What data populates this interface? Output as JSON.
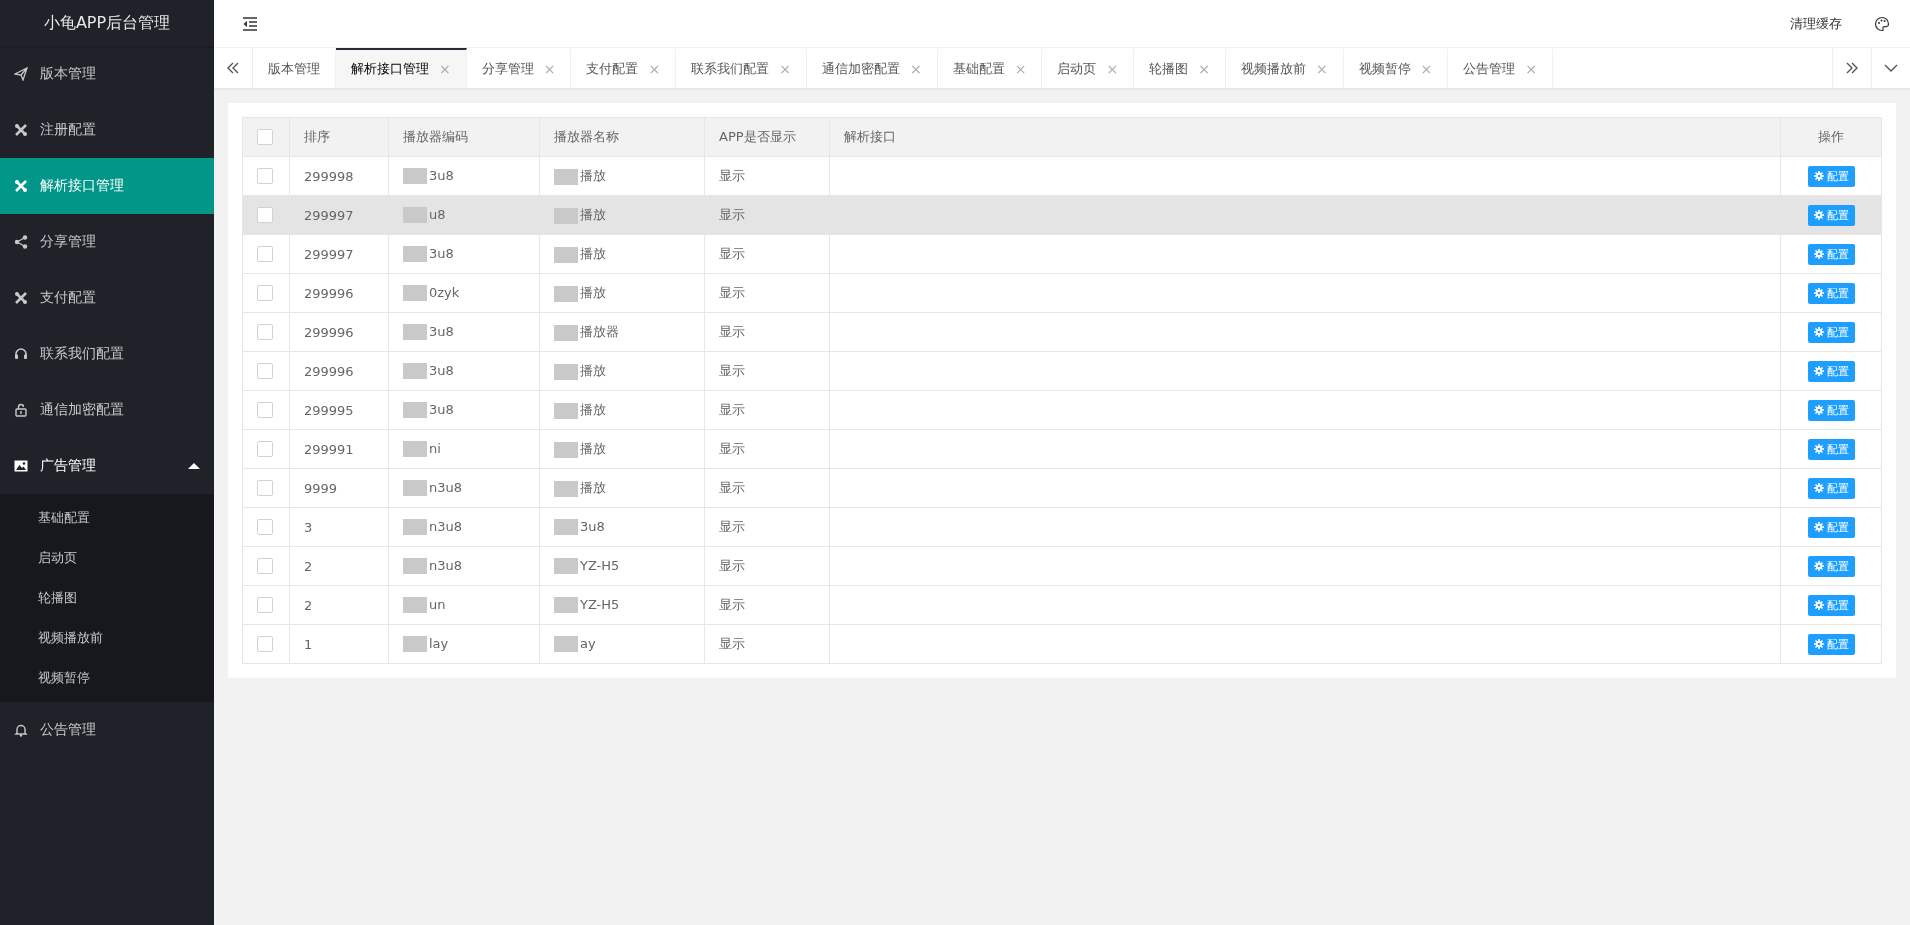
{
  "app_title": "小龟APP后台管理",
  "sidebar": {
    "items": [
      {
        "label": "版本管理",
        "kind": "send",
        "selected": false
      },
      {
        "label": "注册配置",
        "kind": "tools",
        "selected": false
      },
      {
        "label": "解析接口管理",
        "kind": "tools",
        "selected": true
      },
      {
        "label": "分享管理",
        "kind": "share",
        "selected": false
      },
      {
        "label": "支付配置",
        "kind": "tools",
        "selected": false
      },
      {
        "label": "联系我们配置",
        "kind": "headset",
        "selected": false
      },
      {
        "label": "通信加密配置",
        "kind": "lock",
        "selected": false
      },
      {
        "label": "广告管理",
        "kind": "image",
        "selected": false,
        "expanded": true,
        "children": [
          {
            "label": "基础配置",
            "selected": false
          },
          {
            "label": "启动页",
            "selected": false
          },
          {
            "label": "轮播图",
            "selected": false
          },
          {
            "label": "视频播放前",
            "selected": false
          },
          {
            "label": "视频暂停",
            "selected": false
          }
        ]
      },
      {
        "label": "公告管理",
        "kind": "bell",
        "selected": false
      }
    ]
  },
  "header": {
    "clear_cache": "清理缓存"
  },
  "tabs": [
    {
      "label": "版本管理",
      "selected": false,
      "closable": false
    },
    {
      "label": "解析接口管理",
      "selected": true,
      "closable": true
    },
    {
      "label": "分享管理",
      "selected": false,
      "closable": true
    },
    {
      "label": "支付配置",
      "selected": false,
      "closable": true
    },
    {
      "label": "联系我们配置",
      "selected": false,
      "closable": true
    },
    {
      "label": "通信加密配置",
      "selected": false,
      "closable": true
    },
    {
      "label": "基础配置",
      "selected": false,
      "closable": true
    },
    {
      "label": "启动页",
      "selected": false,
      "closable": true
    },
    {
      "label": "轮播图",
      "selected": false,
      "closable": true
    },
    {
      "label": "视频播放前",
      "selected": false,
      "closable": true
    },
    {
      "label": "视频暂停",
      "selected": false,
      "closable": true
    },
    {
      "label": "公告管理",
      "selected": false,
      "closable": true
    }
  ],
  "tab_close_glyph": "×",
  "table": {
    "header_checked": false,
    "columns": [
      "排序",
      "播放器编码",
      "播放器名称",
      "APP是否显示",
      "解析接口",
      "操作"
    ],
    "rows": [
      {
        "checked": false,
        "highlighted": false,
        "order": "299998",
        "code": "3u8",
        "name": "播放",
        "show": "显示",
        "action": "配置"
      },
      {
        "checked": false,
        "highlighted": true,
        "order": "299997",
        "code": "u8",
        "name": "播放",
        "show": "显示",
        "action": "配置"
      },
      {
        "checked": false,
        "highlighted": false,
        "order": "299997",
        "code": "3u8",
        "name": "播放",
        "show": "显示",
        "action": "配置"
      },
      {
        "checked": false,
        "highlighted": false,
        "order": "299996",
        "code": "0zyk",
        "name": "播放",
        "show": "显示",
        "action": "配置"
      },
      {
        "checked": false,
        "highlighted": false,
        "order": "299996",
        "code": "3u8",
        "name": "播放器",
        "show": "显示",
        "action": "配置"
      },
      {
        "checked": false,
        "highlighted": false,
        "order": "299996",
        "code": "3u8",
        "name": "播放",
        "show": "显示",
        "action": "配置"
      },
      {
        "checked": false,
        "highlighted": false,
        "order": "299995",
        "code": "3u8",
        "name": "播放",
        "show": "显示",
        "action": "配置"
      },
      {
        "checked": false,
        "highlighted": false,
        "order": "299991",
        "code": "ni",
        "name": "播放",
        "show": "显示",
        "action": "配置"
      },
      {
        "checked": false,
        "highlighted": false,
        "order": "9999",
        "code": "n3u8",
        "name": "播放",
        "show": "显示",
        "action": "配置"
      },
      {
        "checked": false,
        "highlighted": false,
        "order": "3",
        "code": "n3u8",
        "name": "3u8",
        "show": "显示",
        "action": "配置"
      },
      {
        "checked": false,
        "highlighted": false,
        "order": "2",
        "code": "n3u8",
        "name": "YZ-H5",
        "show": "显示",
        "action": "配置"
      },
      {
        "checked": false,
        "highlighted": false,
        "order": "2",
        "code": "un",
        "name": "YZ-H5",
        "show": "显示",
        "action": "配置"
      },
      {
        "checked": false,
        "highlighted": false,
        "order": "1",
        "code": "lay",
        "name": "ay",
        "show": "显示",
        "action": "配置"
      }
    ]
  }
}
